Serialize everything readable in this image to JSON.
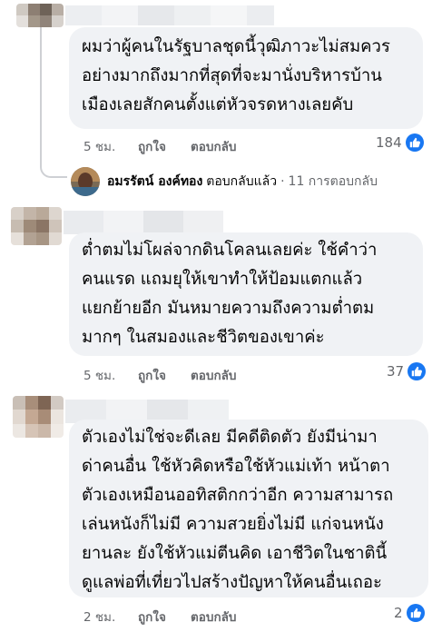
{
  "comments": [
    {
      "lines": [
        "ผมว่าผู้คนในรัฐบาลชุดนี้วุฒิภาวะไม่สมควร",
        "อย่างมากถึงมากที่สุดที่จะมานั่งบริหารบ้าน",
        "เมืองเลยสักคนตั้งแต่หัวจรดหางเลยคับ"
      ],
      "time": "5 ชม.",
      "like_label": "ถูกใจ",
      "reply_label": "ตอบกลับ",
      "reaction_count": "184",
      "reaction_icon": "like-icon"
    },
    {
      "lines": [
        "ต่ำตมไม่โผล่จากดินโคลนเลยค่ะ ใช้คำว่า",
        "คนแรด แถมยุให้เขาทำให้ป้อมแตกแล้ว",
        "แยกย้ายอีก มันหมายความถึงความต่ำตม",
        "มากๆ ในสมองและชีวิตของเขาค่ะ"
      ],
      "time": "5 ชม.",
      "like_label": "ถูกใจ",
      "reply_label": "ตอบกลับ",
      "reaction_count": "37",
      "reaction_icon": "like-icon"
    },
    {
      "lines": [
        "ตัวเองไม่ใช่จะดีเลย มีคดีติดตัว ยังมีน่ามา",
        "ด่าคนอื่น ใช้หัวคิดหรือใช้หัวแม่เท้า หน้าตา",
        "ตัวเองเหมือนออทิสติกกว่าอีก ความสามารถ",
        "เล่นหนังก็ไม่มี ความสวยยิ่งไม่มี แก่จนหนัง",
        "ยานละ ยังใช้หัวแม่ตีนคิด เอาชีวิตในชาตินี้",
        "ดูแลพ่อที่เที่ยวไปสร้างปัญหาให้คนอื่นเถอะ"
      ],
      "time": "2 ชม.",
      "like_label": "ถูกใจ",
      "reply_label": "ตอบกลับ",
      "reaction_count": "2",
      "reaction_icon": "like-icon"
    }
  ],
  "reply": {
    "author": "อมรรัตน์ องค์ทอง",
    "action": "ตอบกลับแล้ว",
    "separator": "·",
    "count_text": "11 การตอบกลับ",
    "icon": "reply-arrow-icon"
  },
  "colors": {
    "bubble": "#f0f2f5",
    "meta_text": "#65676b",
    "like_blue": "#1877f2"
  }
}
